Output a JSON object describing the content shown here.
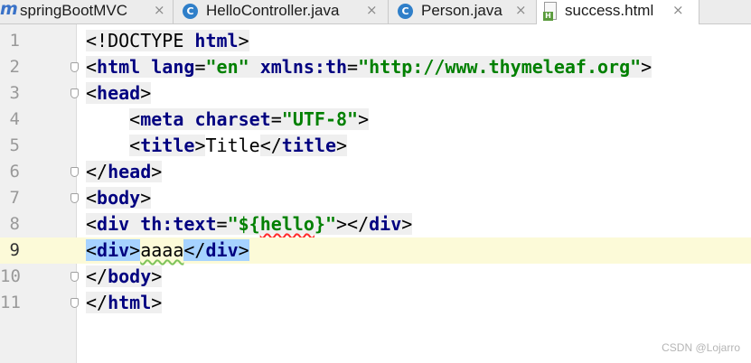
{
  "tabs": [
    {
      "label": "springBootMVC",
      "icon": "maven-module-icon",
      "active": false
    },
    {
      "label": "HelloController.java",
      "icon": "java-class-icon",
      "active": false
    },
    {
      "label": "Person.java",
      "icon": "java-class-icon",
      "active": false
    },
    {
      "label": "success.html",
      "icon": "html-file-icon",
      "active": true
    }
  ],
  "tab_close_glyph": "×",
  "editor": {
    "current_line": 9,
    "lines": [
      {
        "n": "1"
      },
      {
        "n": "2"
      },
      {
        "n": "3"
      },
      {
        "n": "4"
      },
      {
        "n": "5"
      },
      {
        "n": "6"
      },
      {
        "n": "7"
      },
      {
        "n": "8"
      },
      {
        "n": "9"
      },
      {
        "n": "10"
      },
      {
        "n": "11"
      }
    ],
    "tokens": {
      "l1": [
        "<!DOCTYPE ",
        "html",
        ">"
      ],
      "l2": [
        "<",
        "html",
        " ",
        "lang",
        "=",
        "\"en\"",
        " ",
        "xmlns:th",
        "=",
        "\"http://www.thymeleaf.org\"",
        ">"
      ],
      "l3": [
        "<",
        "head",
        ">"
      ],
      "l4_indent": "    ",
      "l4": [
        "<",
        "meta",
        " ",
        "charset",
        "=",
        "\"UTF-8\"",
        ">"
      ],
      "l5": [
        "<",
        "title",
        ">",
        "Title",
        "</",
        "title",
        ">"
      ],
      "l6": [
        "</",
        "head",
        ">"
      ],
      "l7": [
        "<",
        "body",
        ">"
      ],
      "l8": [
        "<",
        "div",
        " ",
        "th:text",
        "=",
        "\"${",
        "hello",
        "}\"",
        "></",
        "div",
        ">"
      ],
      "l9": [
        "<",
        "div",
        ">",
        "aaaa",
        "</",
        "div",
        ">"
      ],
      "l10": [
        "</",
        "body",
        ">"
      ],
      "l11": [
        "</",
        "html",
        ">"
      ]
    }
  },
  "colors": {
    "tag": "#000080",
    "string": "#008000",
    "current_line": "#fcfad8",
    "selection": "#a6d2ff"
  },
  "watermark": "CSDN @Lojarro"
}
